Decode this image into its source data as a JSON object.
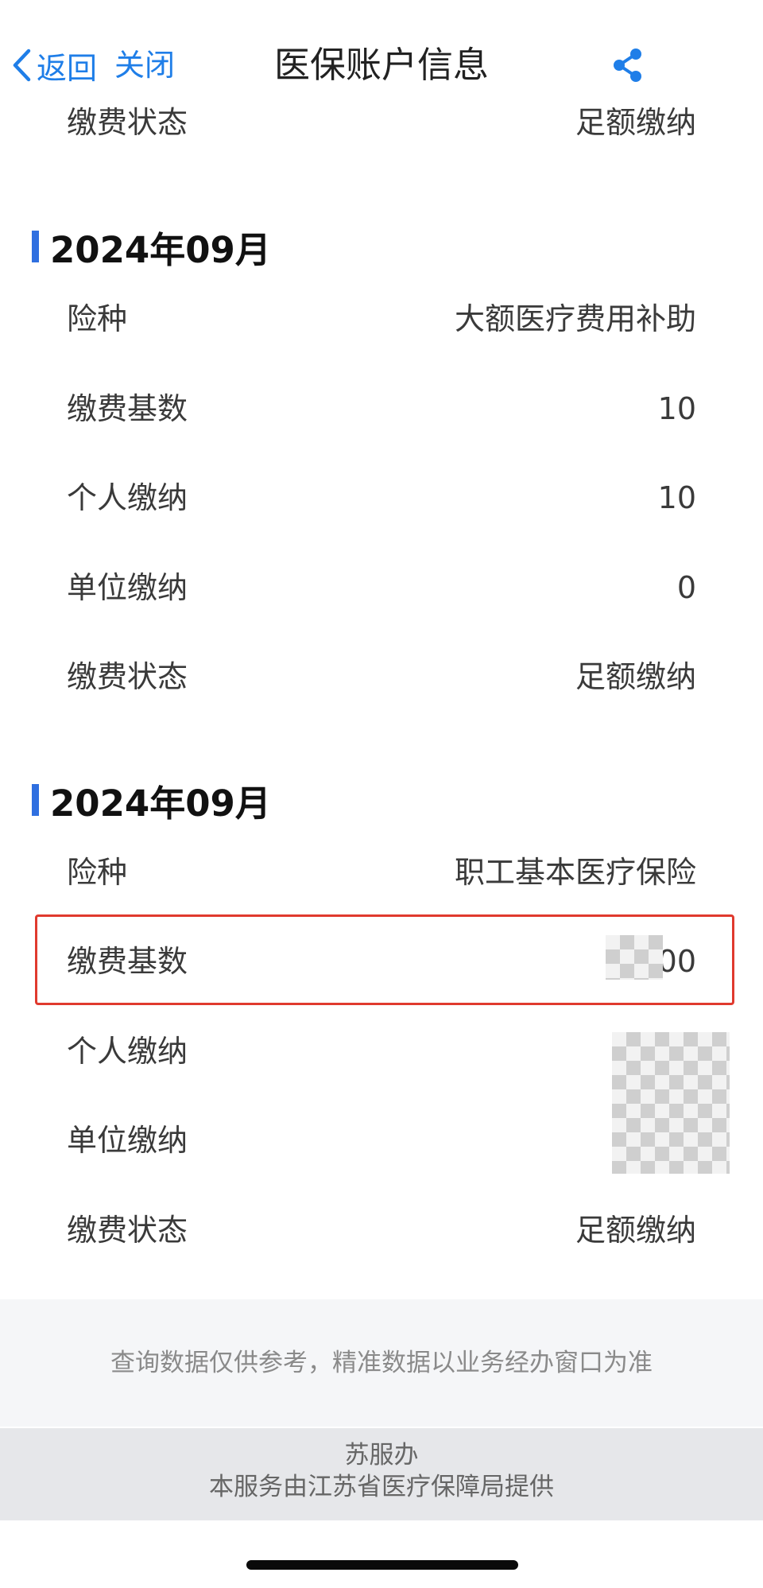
{
  "nav": {
    "back_label": "返回",
    "close_label": "关闭",
    "title": "医保账户信息",
    "accent_color": "#1f7ee8"
  },
  "top_partial": {
    "label": "缴费状态",
    "value": "足额缴纳"
  },
  "records": [
    {
      "month": "2024年09月",
      "rows": [
        {
          "label": "险种",
          "value": "大额医疗费用补助"
        },
        {
          "label": "缴费基数",
          "value": "10"
        },
        {
          "label": "个人缴纳",
          "value": "10"
        },
        {
          "label": "单位缴纳",
          "value": "0"
        },
        {
          "label": "缴费状态",
          "value": "足额缴纳"
        }
      ]
    },
    {
      "month": "2024年09月",
      "rows": [
        {
          "label": "险种",
          "value": "职工基本医疗保险"
        },
        {
          "label": "缴费基数",
          "value": "00"
        },
        {
          "label": "个人缴纳",
          "value": ""
        },
        {
          "label": "单位缴纳",
          "value": ""
        },
        {
          "label": "缴费状态",
          "value": "足额缴纳"
        }
      ]
    }
  ],
  "disclaimer": "查询数据仅供参考，精准数据以业务经办窗口为准",
  "footer": {
    "brand": "苏服办",
    "provider": "本服务由江苏省医疗保障局提供"
  },
  "icons": {
    "back": "chevron-left-icon",
    "share": "share-icon"
  }
}
